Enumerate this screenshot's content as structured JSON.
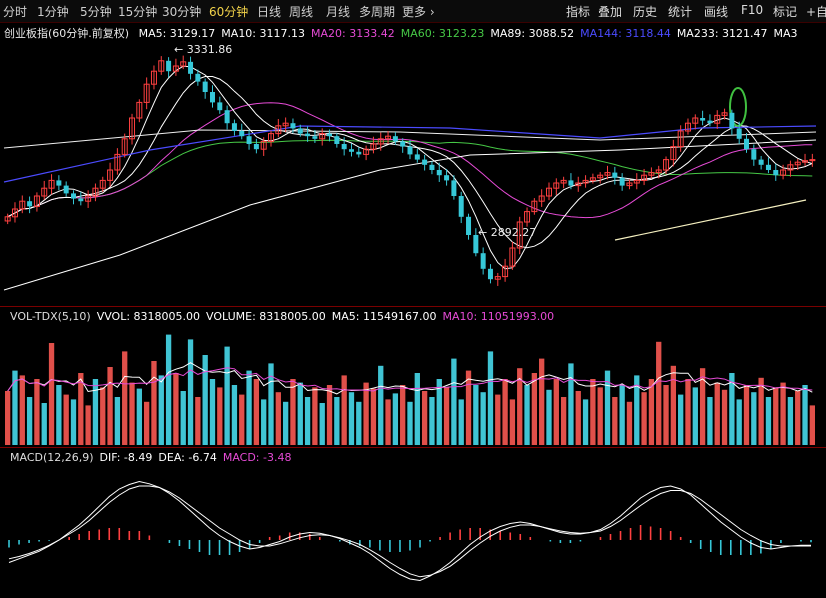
{
  "toolbar": {
    "periods": [
      "分时",
      "1分钟",
      "5分钟",
      "15分钟",
      "30分钟",
      "60分钟",
      "日线",
      "周线",
      "月线",
      "多周期",
      "更多 ›"
    ],
    "active_period": "60分钟",
    "right_buttons": [
      "指标",
      "叠加",
      "历史",
      "统计",
      "画线",
      "F10",
      "标记",
      "+自"
    ]
  },
  "price_panel": {
    "title": "创业板指(60分钟.前复权)",
    "ma_labels": [
      {
        "text": "MA5: 3129.17",
        "color": "#ffffff"
      },
      {
        "text": "MA10: 3117.13",
        "color": "#ffffff"
      },
      {
        "text": "MA20: 3133.42",
        "color": "#e64bd6"
      },
      {
        "text": "MA60: 3123.23",
        "color": "#46c846"
      },
      {
        "text": "MA89: 3088.52",
        "color": "#ffffff"
      },
      {
        "text": "MA144: 3118.44",
        "color": "#4b4bff"
      },
      {
        "text": "MA233: 3121.47",
        "color": "#ffffff"
      },
      {
        "text": "MA3",
        "color": "#ffffff"
      }
    ],
    "high_label": "3331.86",
    "low_label": "2892.27"
  },
  "volume_panel": {
    "labels": [
      {
        "text": "VOL-TDX(5,10)",
        "color": "#dddddd"
      },
      {
        "text": "VVOL: 8318005.00",
        "color": "#ffffff"
      },
      {
        "text": "VOLUME: 8318005.00",
        "color": "#ffffff"
      },
      {
        "text": "MA5: 11549167.00",
        "color": "#ffffff"
      },
      {
        "text": "MA10: 11051993.00",
        "color": "#e64bd6"
      }
    ]
  },
  "macd_panel": {
    "labels": [
      {
        "text": "MACD(12,26,9)",
        "color": "#dddddd"
      },
      {
        "text": "DIF: -8.49",
        "color": "#ffffff"
      },
      {
        "text": "DEA: -6.74",
        "color": "#ffffff"
      },
      {
        "text": "MACD: -3.48",
        "color": "#e64bd6"
      }
    ]
  },
  "colors": {
    "up": "#ff4040",
    "down": "#36c8d8",
    "vol_up": "#e0504a",
    "vol_down": "#40c4d4"
  },
  "chart_data": [
    {
      "type": "candlestick",
      "title": "创业板指(60分钟.前复权)",
      "ylim": [
        2860,
        3360
      ],
      "annotations": [
        {
          "text": "3331.86",
          "type": "high"
        },
        {
          "text": "2892.27",
          "type": "low"
        }
      ],
      "close": [
        3020,
        3035,
        3050,
        3040,
        3060,
        3075,
        3090,
        3080,
        3065,
        3055,
        3050,
        3060,
        3075,
        3090,
        3110,
        3140,
        3170,
        3210,
        3240,
        3275,
        3300,
        3320,
        3300,
        3310,
        3318,
        3295,
        3280,
        3260,
        3240,
        3225,
        3200,
        3185,
        3175,
        3160,
        3150,
        3165,
        3180,
        3195,
        3200,
        3190,
        3180,
        3175,
        3170,
        3180,
        3175,
        3160,
        3150,
        3145,
        3140,
        3150,
        3160,
        3170,
        3175,
        3165,
        3155,
        3140,
        3130,
        3120,
        3110,
        3100,
        3090,
        3060,
        3020,
        2985,
        2950,
        2920,
        2900,
        2905,
        2925,
        2960,
        3010,
        3030,
        3050,
        3060,
        3075,
        3085,
        3090,
        3080,
        3085,
        3090,
        3095,
        3100,
        3105,
        3095,
        3080,
        3085,
        3090,
        3100,
        3105,
        3110,
        3130,
        3155,
        3185,
        3200,
        3210,
        3205,
        3200,
        3215,
        3220,
        3190,
        3170,
        3150,
        3130,
        3120,
        3110,
        3100,
        3110,
        3120,
        3125,
        3128,
        3130
      ]
    },
    {
      "type": "bar",
      "title": "VOL-TDX(5,10)",
      "note": "relative volume (0-1 of panel max)",
      "values": [
        0.45,
        0.62,
        0.58,
        0.4,
        0.55,
        0.35,
        0.85,
        0.5,
        0.42,
        0.38,
        0.6,
        0.33,
        0.55,
        0.48,
        0.65,
        0.4,
        0.78,
        0.52,
        0.47,
        0.36,
        0.7,
        0.58,
        0.92,
        0.6,
        0.45,
        0.88,
        0.4,
        0.75,
        0.55,
        0.48,
        0.82,
        0.5,
        0.42,
        0.62,
        0.55,
        0.38,
        0.68,
        0.44,
        0.36,
        0.55,
        0.52,
        0.4,
        0.48,
        0.35,
        0.5,
        0.4,
        0.58,
        0.44,
        0.36,
        0.52,
        0.47,
        0.66,
        0.38,
        0.43,
        0.5,
        0.36,
        0.6,
        0.45,
        0.4,
        0.55,
        0.48,
        0.72,
        0.38,
        0.62,
        0.5,
        0.44,
        0.78,
        0.42,
        0.55,
        0.38,
        0.64,
        0.5,
        0.6,
        0.72,
        0.46,
        0.55,
        0.4,
        0.68,
        0.45,
        0.38,
        0.55,
        0.48,
        0.62,
        0.4,
        0.5,
        0.36,
        0.58,
        0.44,
        0.55,
        0.86,
        0.5,
        0.66,
        0.42,
        0.55,
        0.48,
        0.64,
        0.4,
        0.52,
        0.46,
        0.6,
        0.38,
        0.5,
        0.44,
        0.56,
        0.4,
        0.48,
        0.52,
        0.4,
        0.45,
        0.5,
        0.33
      ],
      "up": [
        1,
        0,
        1,
        0,
        1,
        0,
        1,
        0,
        1,
        0,
        1,
        1,
        0,
        1,
        1,
        0,
        1,
        1,
        0,
        1,
        1,
        0,
        0,
        1,
        0,
        0,
        1,
        0,
        0,
        1,
        0,
        0,
        1,
        0,
        1,
        0,
        0,
        1,
        0,
        1,
        0,
        0,
        1,
        0,
        1,
        0,
        1,
        0,
        0,
        1,
        1,
        0,
        1,
        0,
        1,
        0,
        0,
        1,
        0,
        0,
        1,
        0,
        0,
        1,
        0,
        0,
        0,
        1,
        1,
        1,
        1,
        0,
        1,
        1,
        0,
        1,
        1,
        0,
        1,
        0,
        1,
        1,
        0,
        1,
        0,
        1,
        0,
        1,
        1,
        1,
        1,
        1,
        0,
        1,
        0,
        1,
        0,
        1,
        1,
        0,
        0,
        1,
        0,
        1,
        0,
        1,
        1,
        0,
        1,
        0,
        1
      ]
    },
    {
      "type": "bar",
      "title": "MACD(12,26,9)",
      "series": [
        {
          "name": "DIF",
          "values": [
            -30,
            -25,
            -20,
            -15,
            -8,
            0,
            10,
            20,
            32,
            45,
            58,
            68,
            74,
            78,
            75,
            70,
            62,
            52,
            40,
            28,
            16,
            6,
            -2,
            -8,
            -12,
            -10,
            -6,
            -2,
            4,
            8,
            10,
            9,
            6,
            2,
            -4,
            -10,
            -18,
            -28,
            -38,
            -46,
            -52,
            -54,
            -48,
            -40,
            -30,
            -18,
            -6,
            4,
            12,
            18,
            22,
            24,
            22,
            18,
            14,
            10,
            8,
            8,
            10,
            14,
            22,
            32,
            44,
            56,
            64,
            70,
            72,
            68,
            60,
            48,
            36,
            24,
            14,
            4,
            -4,
            -10,
            -12,
            -10,
            -8,
            -8,
            -8
          ]
        },
        {
          "name": "DEA",
          "values": [
            -25,
            -22,
            -18,
            -13,
            -7,
            0,
            8,
            16,
            26,
            38,
            50,
            60,
            68,
            72,
            72,
            70,
            64,
            56,
            46,
            36,
            26,
            16,
            8,
            0,
            -6,
            -8,
            -8,
            -5,
            -1,
            3,
            6,
            7,
            6,
            3,
            -1,
            -6,
            -13,
            -21,
            -30,
            -38,
            -45,
            -49,
            -47,
            -42,
            -35,
            -25,
            -14,
            -4,
            5,
            12,
            17,
            20,
            20,
            18,
            15,
            12,
            10,
            9,
            10,
            12,
            18,
            26,
            36,
            46,
            55,
            62,
            66,
            66,
            62,
            54,
            44,
            34,
            24,
            14,
            6,
            -1,
            -6,
            -8,
            -8,
            -7,
            -7
          ]
        },
        {
          "name": "MACD",
          "values": [
            -10,
            -6,
            -4,
            -2,
            -1,
            0,
            4,
            8,
            12,
            14,
            16,
            16,
            12,
            12,
            6,
            0,
            -4,
            -8,
            -12,
            -16,
            -20,
            -20,
            -20,
            -16,
            -12,
            -4,
            4,
            6,
            10,
            10,
            8,
            4,
            0,
            -2,
            -6,
            -8,
            -10,
            -14,
            -16,
            -16,
            -14,
            -10,
            -2,
            4,
            10,
            14,
            16,
            16,
            14,
            12,
            10,
            8,
            4,
            0,
            -2,
            -4,
            -4,
            -2,
            0,
            4,
            8,
            12,
            16,
            20,
            18,
            16,
            12,
            4,
            -4,
            -12,
            -16,
            -20,
            -20,
            -20,
            -20,
            -18,
            -12,
            -4,
            0,
            -2,
            -3
          ]
        }
      ]
    }
  ]
}
